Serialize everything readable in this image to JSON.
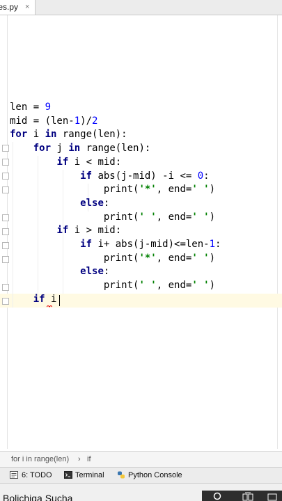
{
  "tab": {
    "label": "oles.py",
    "close": "×"
  },
  "code": {
    "lines": [
      "len = 9",
      "mid = (len-1)/2",
      "for i in range(len):",
      "    for j in range(len):",
      "        if i < mid:",
      "            if abs(j-mid) -i <= 0:",
      "                print('*', end=' ')",
      "            else:",
      "                print(' ', end=' ')",
      "        if i > mid:",
      "            if i+ abs(j-mid)<=len-1:",
      "                print('*', end=' ')",
      "            else:",
      "                print(' ', end=' ')",
      "    if i"
    ]
  },
  "breadcrumb": {
    "item1": "for i in range(len)",
    "separator": "›",
    "item2": "if"
  },
  "toolwindows": {
    "todo": "6: TODO",
    "terminal": "Terminal",
    "python_console": "Python Console"
  },
  "status": {
    "text": "Bolichiga Sucha"
  },
  "colors": {
    "keyword": "#000080",
    "number": "#0000ff",
    "string": "#008000",
    "current_line": "#fffae3"
  }
}
